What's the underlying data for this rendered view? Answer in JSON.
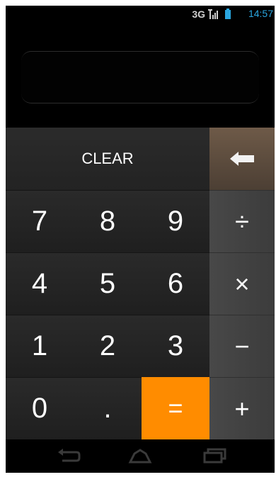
{
  "status_bar": {
    "network": "3G",
    "time": "14:57",
    "signal_icon": "signal-bars-icon",
    "battery_icon": "battery-icon"
  },
  "display": {
    "value": ""
  },
  "keypad": {
    "clear_label": "CLEAR",
    "backspace_icon": "backspace-arrow-icon",
    "rows": [
      [
        "7",
        "8",
        "9"
      ],
      [
        "4",
        "5",
        "6"
      ],
      [
        "1",
        "2",
        "3"
      ],
      [
        "0",
        ".",
        "="
      ]
    ],
    "operators": [
      "÷",
      "×",
      "−",
      "+"
    ]
  },
  "nav_bar": {
    "icons": [
      "back-icon",
      "home-icon",
      "recent-apps-icon"
    ]
  },
  "colors": {
    "accent_equals": "#ff8c00",
    "time_color": "#2aa6e0",
    "backspace_bg": "#5e4c3e"
  }
}
